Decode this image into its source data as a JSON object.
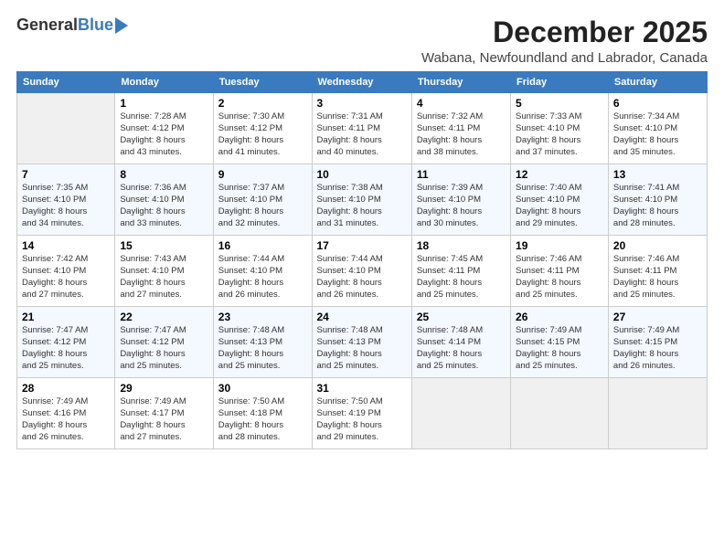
{
  "logo": {
    "general": "General",
    "blue": "Blue"
  },
  "header": {
    "month": "December 2025",
    "location": "Wabana, Newfoundland and Labrador, Canada"
  },
  "columns": [
    "Sunday",
    "Monday",
    "Tuesday",
    "Wednesday",
    "Thursday",
    "Friday",
    "Saturday"
  ],
  "weeks": [
    [
      {
        "day": "",
        "info": ""
      },
      {
        "day": "1",
        "info": "Sunrise: 7:28 AM\nSunset: 4:12 PM\nDaylight: 8 hours\nand 43 minutes."
      },
      {
        "day": "2",
        "info": "Sunrise: 7:30 AM\nSunset: 4:12 PM\nDaylight: 8 hours\nand 41 minutes."
      },
      {
        "day": "3",
        "info": "Sunrise: 7:31 AM\nSunset: 4:11 PM\nDaylight: 8 hours\nand 40 minutes."
      },
      {
        "day": "4",
        "info": "Sunrise: 7:32 AM\nSunset: 4:11 PM\nDaylight: 8 hours\nand 38 minutes."
      },
      {
        "day": "5",
        "info": "Sunrise: 7:33 AM\nSunset: 4:10 PM\nDaylight: 8 hours\nand 37 minutes."
      },
      {
        "day": "6",
        "info": "Sunrise: 7:34 AM\nSunset: 4:10 PM\nDaylight: 8 hours\nand 35 minutes."
      }
    ],
    [
      {
        "day": "7",
        "info": "Sunrise: 7:35 AM\nSunset: 4:10 PM\nDaylight: 8 hours\nand 34 minutes."
      },
      {
        "day": "8",
        "info": "Sunrise: 7:36 AM\nSunset: 4:10 PM\nDaylight: 8 hours\nand 33 minutes."
      },
      {
        "day": "9",
        "info": "Sunrise: 7:37 AM\nSunset: 4:10 PM\nDaylight: 8 hours\nand 32 minutes."
      },
      {
        "day": "10",
        "info": "Sunrise: 7:38 AM\nSunset: 4:10 PM\nDaylight: 8 hours\nand 31 minutes."
      },
      {
        "day": "11",
        "info": "Sunrise: 7:39 AM\nSunset: 4:10 PM\nDaylight: 8 hours\nand 30 minutes."
      },
      {
        "day": "12",
        "info": "Sunrise: 7:40 AM\nSunset: 4:10 PM\nDaylight: 8 hours\nand 29 minutes."
      },
      {
        "day": "13",
        "info": "Sunrise: 7:41 AM\nSunset: 4:10 PM\nDaylight: 8 hours\nand 28 minutes."
      }
    ],
    [
      {
        "day": "14",
        "info": "Sunrise: 7:42 AM\nSunset: 4:10 PM\nDaylight: 8 hours\nand 27 minutes."
      },
      {
        "day": "15",
        "info": "Sunrise: 7:43 AM\nSunset: 4:10 PM\nDaylight: 8 hours\nand 27 minutes."
      },
      {
        "day": "16",
        "info": "Sunrise: 7:44 AM\nSunset: 4:10 PM\nDaylight: 8 hours\nand 26 minutes."
      },
      {
        "day": "17",
        "info": "Sunrise: 7:44 AM\nSunset: 4:10 PM\nDaylight: 8 hours\nand 26 minutes."
      },
      {
        "day": "18",
        "info": "Sunrise: 7:45 AM\nSunset: 4:11 PM\nDaylight: 8 hours\nand 25 minutes."
      },
      {
        "day": "19",
        "info": "Sunrise: 7:46 AM\nSunset: 4:11 PM\nDaylight: 8 hours\nand 25 minutes."
      },
      {
        "day": "20",
        "info": "Sunrise: 7:46 AM\nSunset: 4:11 PM\nDaylight: 8 hours\nand 25 minutes."
      }
    ],
    [
      {
        "day": "21",
        "info": "Sunrise: 7:47 AM\nSunset: 4:12 PM\nDaylight: 8 hours\nand 25 minutes."
      },
      {
        "day": "22",
        "info": "Sunrise: 7:47 AM\nSunset: 4:12 PM\nDaylight: 8 hours\nand 25 minutes."
      },
      {
        "day": "23",
        "info": "Sunrise: 7:48 AM\nSunset: 4:13 PM\nDaylight: 8 hours\nand 25 minutes."
      },
      {
        "day": "24",
        "info": "Sunrise: 7:48 AM\nSunset: 4:13 PM\nDaylight: 8 hours\nand 25 minutes."
      },
      {
        "day": "25",
        "info": "Sunrise: 7:48 AM\nSunset: 4:14 PM\nDaylight: 8 hours\nand 25 minutes."
      },
      {
        "day": "26",
        "info": "Sunrise: 7:49 AM\nSunset: 4:15 PM\nDaylight: 8 hours\nand 25 minutes."
      },
      {
        "day": "27",
        "info": "Sunrise: 7:49 AM\nSunset: 4:15 PM\nDaylight: 8 hours\nand 26 minutes."
      }
    ],
    [
      {
        "day": "28",
        "info": "Sunrise: 7:49 AM\nSunset: 4:16 PM\nDaylight: 8 hours\nand 26 minutes."
      },
      {
        "day": "29",
        "info": "Sunrise: 7:49 AM\nSunset: 4:17 PM\nDaylight: 8 hours\nand 27 minutes."
      },
      {
        "day": "30",
        "info": "Sunrise: 7:50 AM\nSunset: 4:18 PM\nDaylight: 8 hours\nand 28 minutes."
      },
      {
        "day": "31",
        "info": "Sunrise: 7:50 AM\nSunset: 4:19 PM\nDaylight: 8 hours\nand 29 minutes."
      },
      {
        "day": "",
        "info": ""
      },
      {
        "day": "",
        "info": ""
      },
      {
        "day": "",
        "info": ""
      }
    ]
  ]
}
